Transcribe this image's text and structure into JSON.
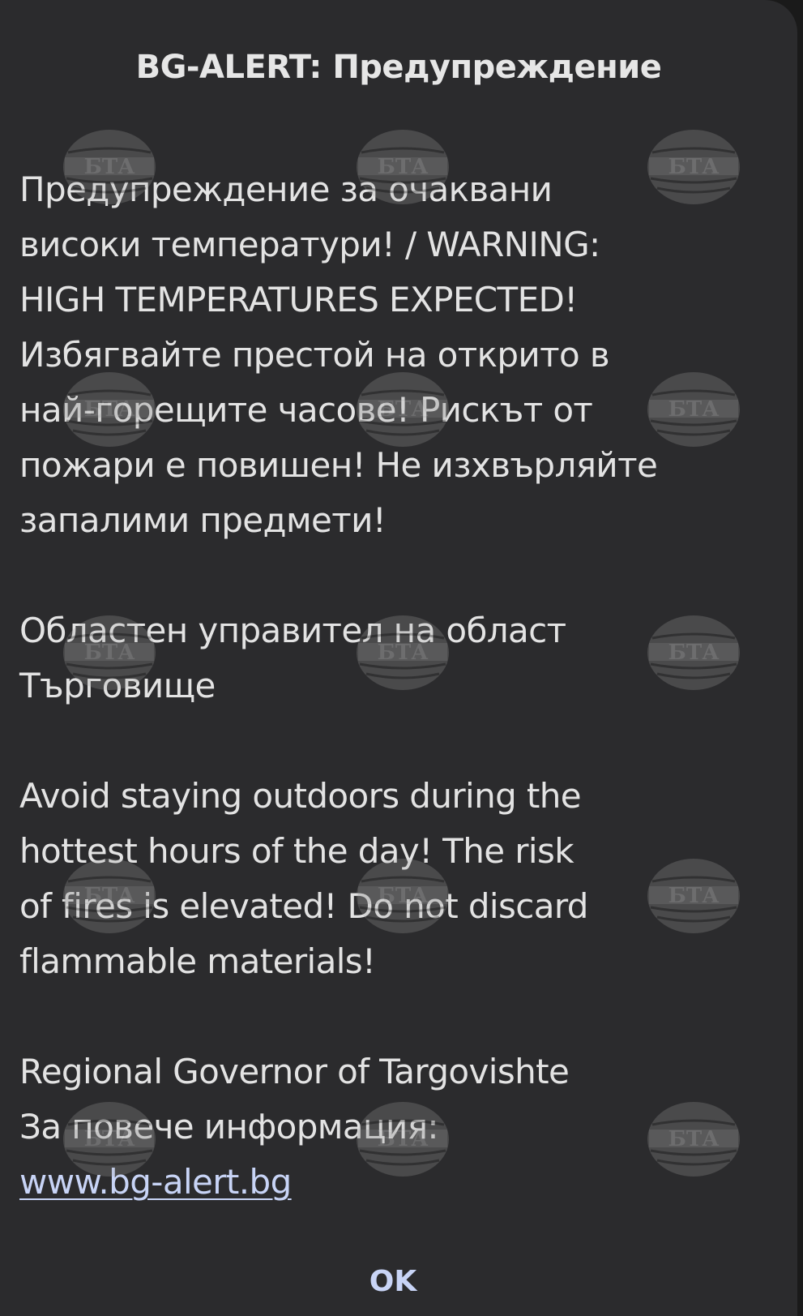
{
  "alert": {
    "title": "BG-ALERT: Предупреждение",
    "paragraph1": [
      "Предупреждение за очаквани",
      "високи температури! / WARNING:",
      "HIGH TEMPERATURES EXPECTED!",
      "Избягвайте престой на открито в",
      "най-горещите часове! Рискът от",
      "пожари е повишен! Не изхвърляйте",
      "запалими предмети!"
    ],
    "paragraph2": [
      "Областен управител на област",
      "Търговище"
    ],
    "paragraph3": [
      "Avoid staying outdoors during the",
      "hottest hours of the day! The risk",
      "of fires is elevated! Do not discard",
      "flammable materials!"
    ],
    "paragraph4": [
      "Regional Governor of Targovishte",
      "За повече информация:"
    ],
    "link_text": "www.bg-alert.bg",
    "ok_label": "OK"
  },
  "watermark": {
    "text": "БТА"
  },
  "colors": {
    "background": "#2b2b2d",
    "text": "#e3e3e3",
    "accent": "#c8d4f6"
  }
}
